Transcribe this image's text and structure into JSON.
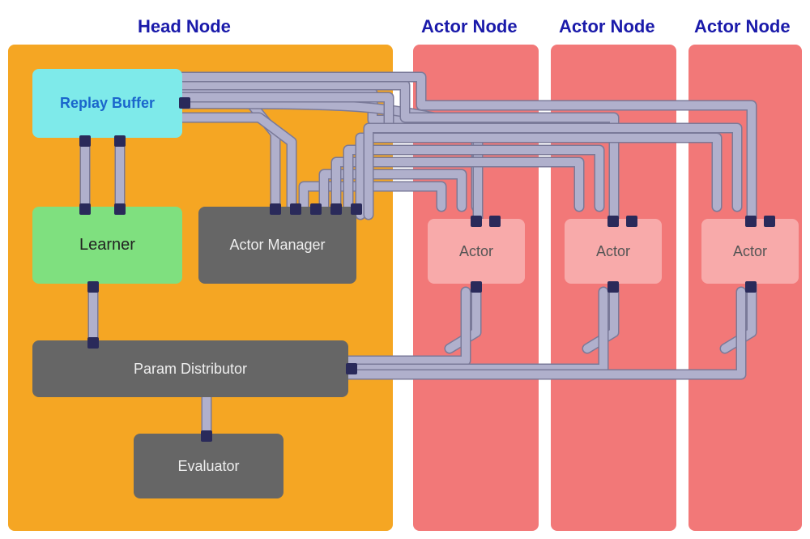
{
  "regions": {
    "head_node": {
      "label": "Head Node"
    },
    "actor_node_1": {
      "label": "Actor Node"
    },
    "actor_node_2": {
      "label": "Actor Node"
    },
    "actor_node_3": {
      "label": "Actor Node"
    }
  },
  "boxes": {
    "replay_buffer": {
      "label": "Replay Buffer"
    },
    "learner": {
      "label": "Learner"
    },
    "actor_manager": {
      "label": "Actor Manager"
    },
    "param_distributor": {
      "label": "Param Distributor"
    },
    "evaluator": {
      "label": "Evaluator"
    },
    "actor_1": {
      "label": "Actor"
    },
    "actor_2": {
      "label": "Actor"
    },
    "actor_3": {
      "label": "Actor"
    }
  },
  "colors": {
    "head_bg": "#F5A623",
    "actor_node_bg": "#F06060",
    "replay_buffer_bg": "#7EEAEA",
    "learner_bg": "#7FE07F",
    "dark_box_bg": "#666666",
    "actor_box_bg": "#F8AAAA",
    "pin_color": "#2a2a5a",
    "wire_color": "#aaaacc",
    "wire_outline": "#888899",
    "label_color": "#1a1aaa"
  }
}
